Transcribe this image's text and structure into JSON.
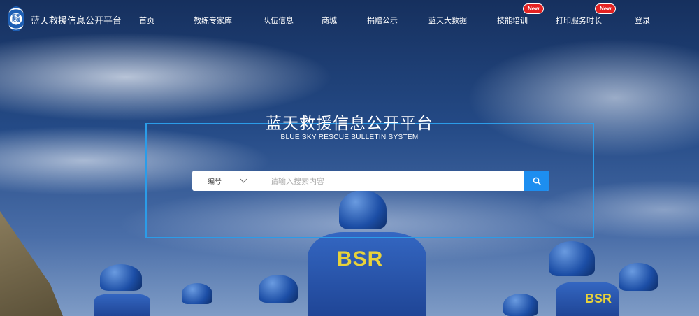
{
  "header": {
    "site_title": "蓝天救援信息公开平台",
    "logo_text": "蓝天救援",
    "nav": [
      {
        "label": "首页"
      },
      {
        "label": "教练专家库"
      },
      {
        "label": "队伍信息"
      },
      {
        "label": "商城"
      },
      {
        "label": "捐赠公示"
      },
      {
        "label": "蓝天大数据"
      },
      {
        "label": "技能培训",
        "badge": "New"
      },
      {
        "label": "打印服务时长",
        "badge": "New"
      },
      {
        "label": "登录"
      }
    ]
  },
  "hero": {
    "title": "蓝天救援信息公开平台",
    "subtitle": "BLUE SKY RESCUE BULLETIN SYSTEM"
  },
  "search": {
    "type_selected": "编号",
    "placeholder": "请输入搜索内容",
    "value": ""
  },
  "background": {
    "vest_text": "BSR",
    "vest_text_right": "BSR"
  },
  "colors": {
    "accent": "#1d8ef0",
    "frame": "#2b9ce8",
    "badge": "#e32222"
  }
}
